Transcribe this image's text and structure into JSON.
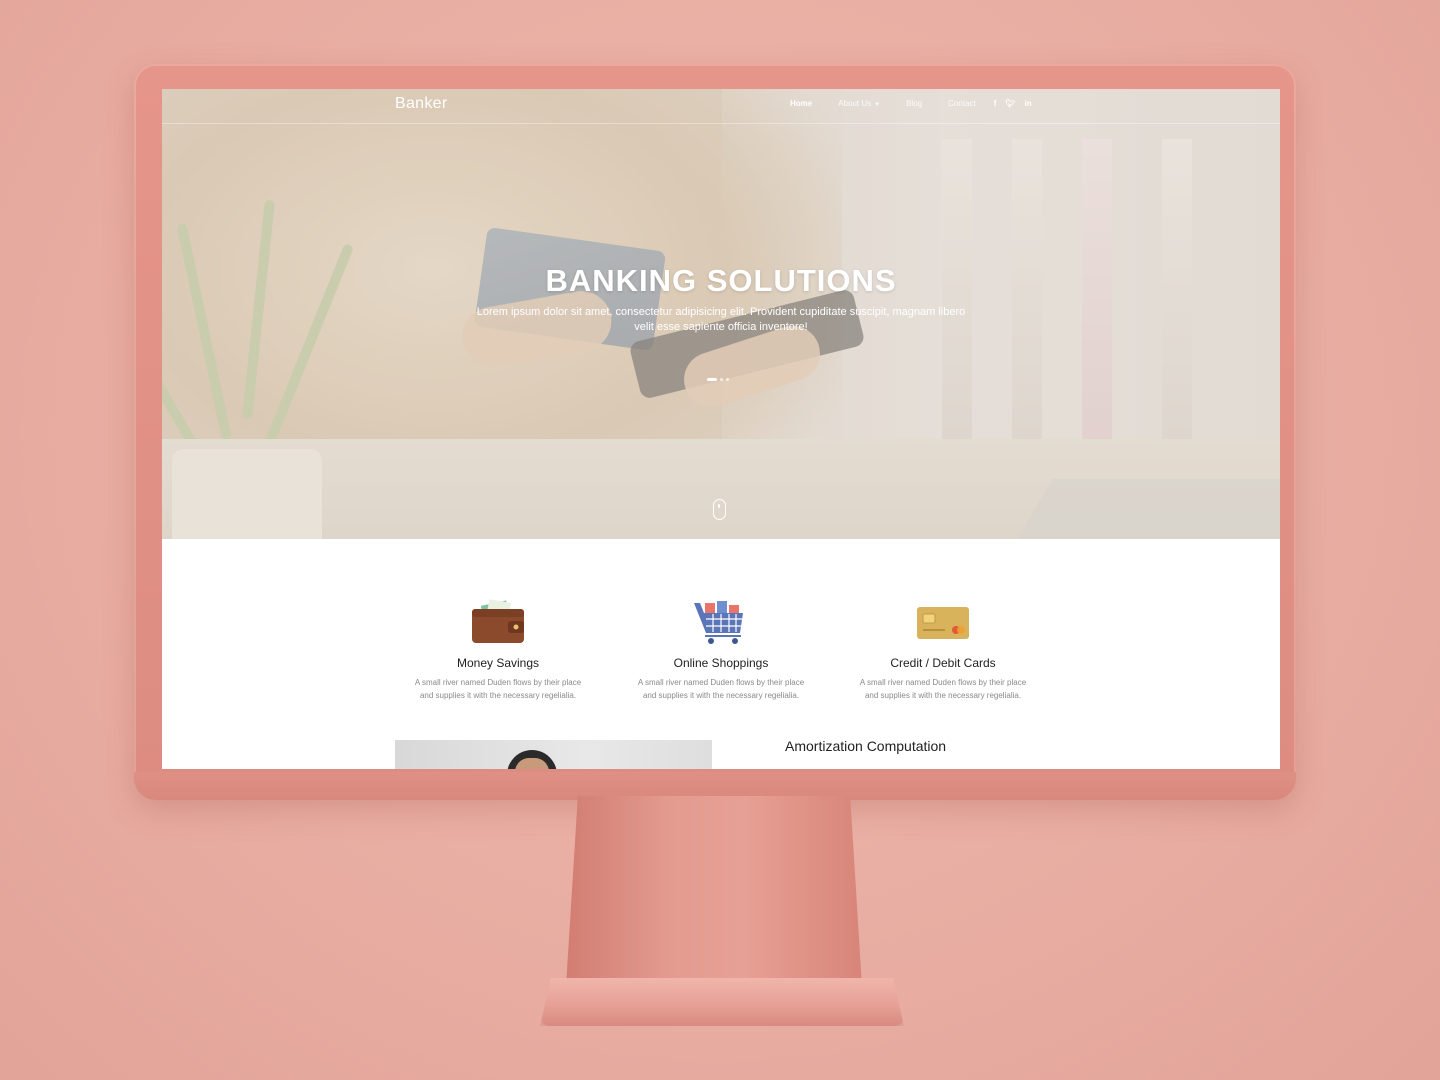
{
  "site": {
    "brand": "Banker",
    "nav": [
      {
        "label": "Home",
        "active": true
      },
      {
        "label": "About Us",
        "active": false,
        "has_dropdown": true
      },
      {
        "label": "Blog",
        "active": false
      },
      {
        "label": "Contact",
        "active": false
      }
    ],
    "social": {
      "facebook": "f",
      "twitter": "t",
      "linkedin": "in"
    }
  },
  "hero": {
    "title": "BANKING SOLUTIONS",
    "subtitle": "Lorem ipsum dolor sit amet, consectetur adipisicing elit. Provident cupiditate suscipit, magnam libero velit esse sapiente officia inventore!",
    "slides": 3,
    "active_slide": 1
  },
  "features": [
    {
      "icon": "wallet-icon",
      "title": "Money Savings",
      "text": "A small river named Duden flows by their place and supplies it with the necessary regelialia."
    },
    {
      "icon": "shopping-cart-icon",
      "title": "Online Shoppings",
      "text": "A small river named Duden flows by their place and supplies it with the necessary regelialia."
    },
    {
      "icon": "credit-card-icon",
      "title": "Credit / Debit Cards",
      "text": "A small river named Duden flows by their place and supplies it with the necessary regelialia."
    }
  ],
  "amortization": {
    "title": "Amortization Computation"
  },
  "colors": {
    "background": "#e9aea3",
    "monitor": "#df9084",
    "accent_brown": "#8b4a2b",
    "card_gold": "#d9b25c"
  }
}
